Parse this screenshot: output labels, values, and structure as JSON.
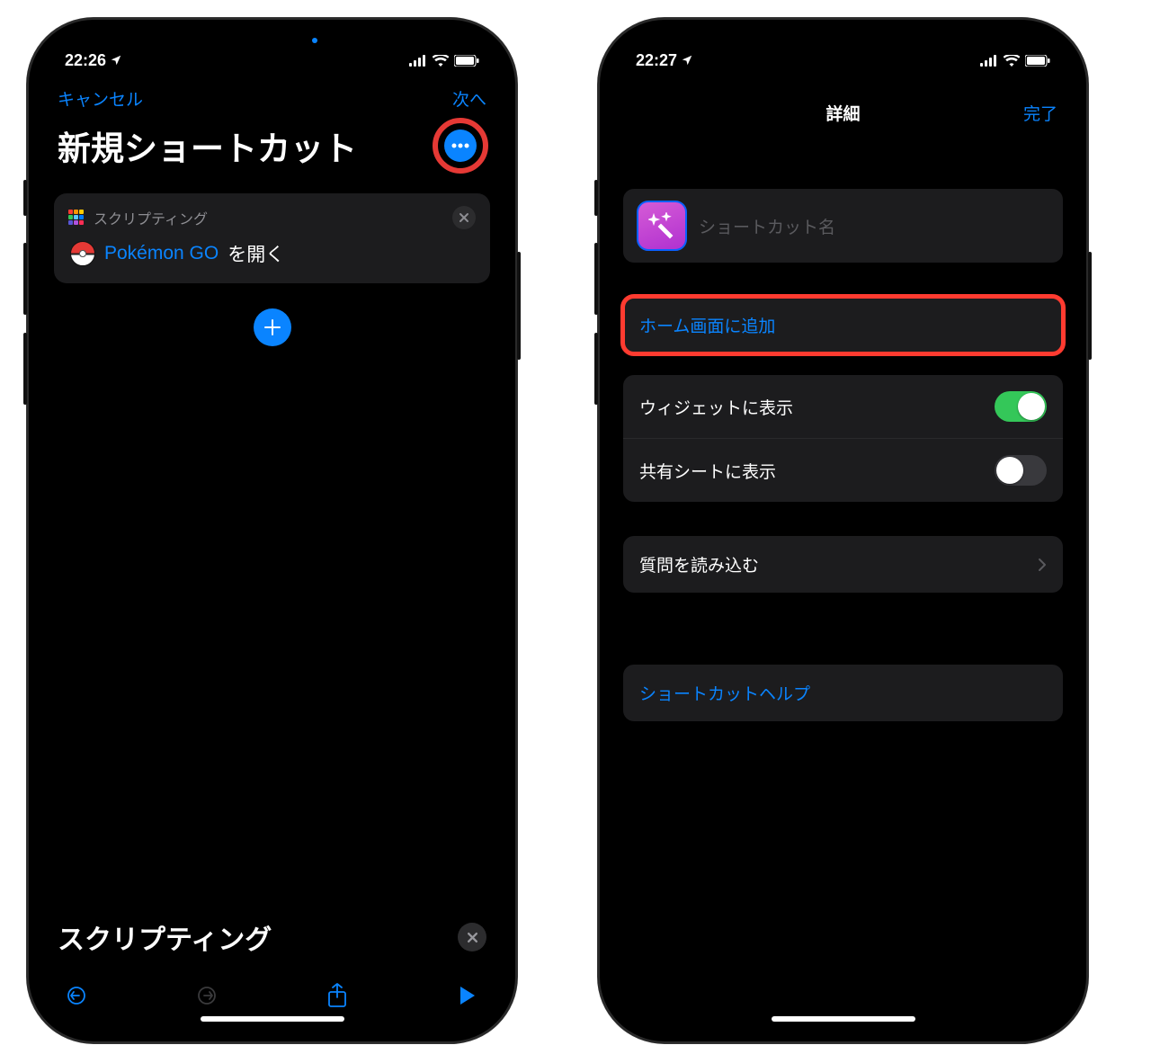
{
  "left": {
    "status": {
      "time": "22:26"
    },
    "nav": {
      "cancel": "キャンセル",
      "next": "次へ"
    },
    "title": "新規ショートカット",
    "card": {
      "category": "スクリプティング",
      "app_name": "Pokémon GO",
      "action_suffix": " を開く"
    },
    "search_label": "スクリプティング"
  },
  "right": {
    "status": {
      "time": "22:27"
    },
    "nav": {
      "title": "詳細",
      "done": "完了"
    },
    "name_placeholder": "ショートカット名",
    "rows": {
      "add_home": "ホーム画面に追加",
      "widget": "ウィジェットに表示",
      "share_sheet": "共有シートに表示",
      "import_questions": "質問を読み込む",
      "help": "ショートカットヘルプ"
    },
    "toggles": {
      "widget": true,
      "share_sheet": false
    }
  }
}
